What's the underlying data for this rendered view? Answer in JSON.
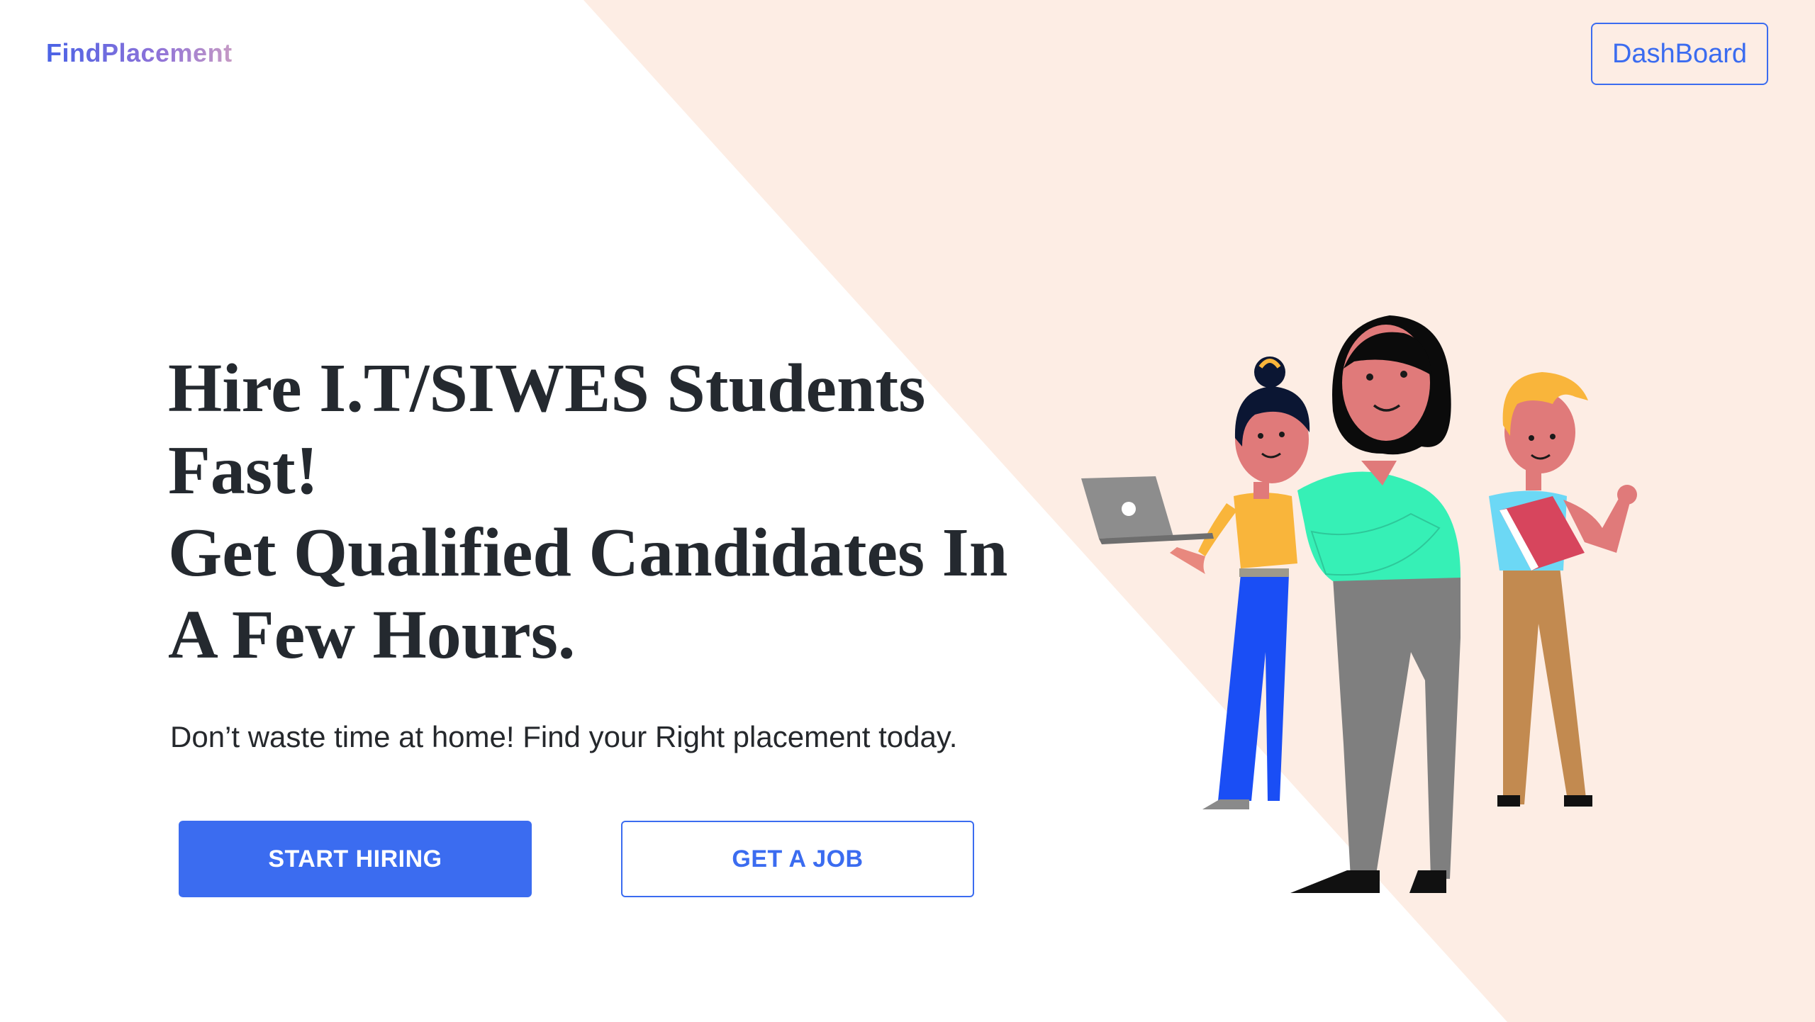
{
  "header": {
    "logo_text": "FindPlacement",
    "dashboard_label": "DashBoard"
  },
  "hero": {
    "headline_line1": "Hire I.T/SIWES Students",
    "headline_line2": "Fast!",
    "headline_line3": "Get Qualified Candidates In",
    "headline_line4": "A Few Hours.",
    "subtitle": "Don’t waste time at home! Find your Right placement today.",
    "primary_button": "START HIRING",
    "secondary_button": "GET A JOB"
  },
  "illustration": {
    "icon": "team-of-students-illustration",
    "laptop_icon": "laptop-icon"
  },
  "colors": {
    "accent": "#3b6cf0",
    "background_diagonal": "#fdede4",
    "text_dark": "#24292f",
    "white": "#ffffff"
  }
}
